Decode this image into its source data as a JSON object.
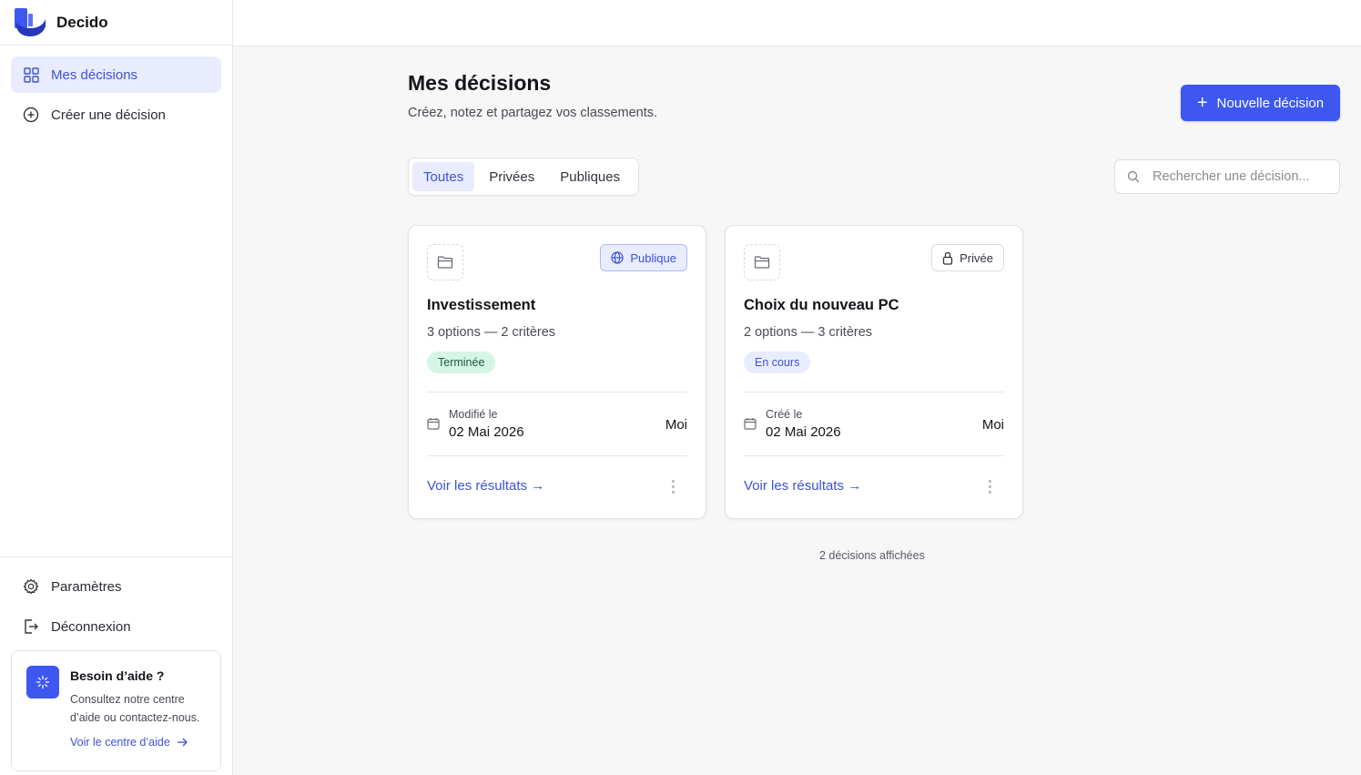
{
  "app": {
    "name": "Decido"
  },
  "sidebar": {
    "nav": [
      {
        "label": "Mes décisions",
        "icon": "grid-icon",
        "active": true
      },
      {
        "label": "Créer une décision",
        "icon": "plus-circle-icon",
        "active": false
      }
    ],
    "bottom": [
      {
        "label": "Paramètres",
        "icon": "gear-icon"
      },
      {
        "label": "Déconnexion",
        "icon": "logout-icon"
      }
    ],
    "help": {
      "title": "Besoin d’aide ?",
      "text": "Consultez notre centre d’aide ou contactez-nous.",
      "link": "Voir le centre d’aide"
    }
  },
  "main": {
    "title": "Mes décisions",
    "subtitle": "Créez, notez et partagez vos classements.",
    "new_button": "Nouvelle décision",
    "tabs": [
      "Toutes",
      "Privées",
      "Publiques"
    ],
    "active_tab": "Toutes",
    "search_placeholder": "Rechercher une décision...",
    "cards": [
      {
        "title": "Investissement",
        "meta": "3 options — 2 critères",
        "visibility": "Publique",
        "status": "Terminée",
        "date_label": "Modifié le",
        "date": "02 Mai 2026",
        "owner": "Moi",
        "link": "Voir les résultats →"
      },
      {
        "title": "Choix du nouveau PC",
        "meta": "2 options — 3 critères",
        "visibility": "Privée",
        "status": "En cours",
        "date_label": "Créé le",
        "date": "02 Mai 2026",
        "owner": "Moi",
        "link": "Voir les résultats →"
      }
    ],
    "count_text": "2 décisions affichées"
  },
  "colors": {
    "accent": "#3d57f0",
    "accent_soft": "#e9ecfd",
    "done_bg": "#d5f5e6",
    "done_text": "#1c5a3c"
  }
}
